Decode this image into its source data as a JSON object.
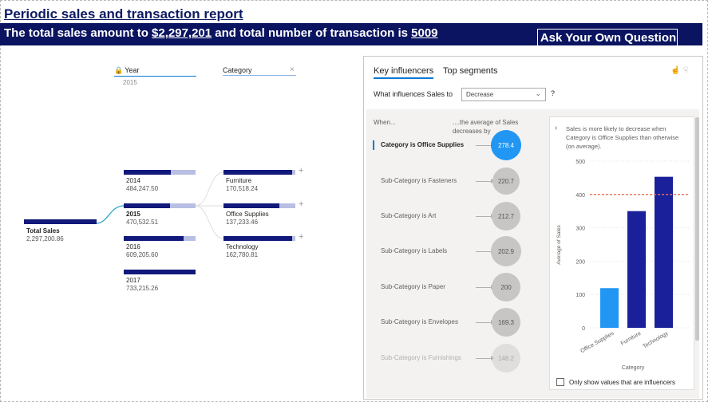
{
  "report": {
    "title": "Periodic sales and transaction report",
    "banner_prefix": "The total sales amount to ",
    "total_sales": "$2,297,201",
    "banner_mid": " and total number of transaction is ",
    "transactions": "5009",
    "ask_button": "Ask Your Own Question",
    "colors": {
      "banner": "#0a1460",
      "bar_dark": "#11197a",
      "bar_light": "#b8bfe3",
      "accent": "#0078d4",
      "bubble_sel": "#2196f3"
    }
  },
  "decomp": {
    "level_year": {
      "label": "Year",
      "sub": "2015",
      "icon": "lock-icon"
    },
    "level_category": {
      "label": "Category",
      "close_icon": "×"
    },
    "root": {
      "name": "Total Sales",
      "value": "2,297,200.86"
    },
    "years": [
      {
        "name": "2014",
        "value": "484,247.50",
        "fill": 0.66,
        "selected": false
      },
      {
        "name": "2015",
        "value": "470,532.51",
        "fill": 0.64,
        "selected": true
      },
      {
        "name": "2016",
        "value": "609,205.60",
        "fill": 0.83,
        "selected": false
      },
      {
        "name": "2017",
        "value": "733,215.26",
        "fill": 1.0,
        "selected": false
      }
    ],
    "categories": [
      {
        "name": "Furniture",
        "value": "170,518.24",
        "fill": 0.95
      },
      {
        "name": "Office Supplies",
        "value": "137,233.46",
        "fill": 0.78
      },
      {
        "name": "Technology",
        "value": "162,780.81",
        "fill": 0.95
      }
    ],
    "plus_glyph": "+"
  },
  "ki": {
    "tabs": [
      "Key influencers",
      "Top segments"
    ],
    "question": "What influences Sales to",
    "dropdown_value": "Decrease",
    "qmark": "?",
    "hdr_when": "When...",
    "hdr_avg": "....the average of Sales decreases by",
    "influencers": [
      {
        "label": "Category is Office Supplies",
        "value": "278.4",
        "size": 38,
        "selected": true
      },
      {
        "label": "Sub-Category is Fasteners",
        "value": "220.7",
        "size": 34
      },
      {
        "label": "Sub-Category is Art",
        "value": "212.7",
        "size": 36
      },
      {
        "label": "Sub-Category is Labels",
        "value": "202.9",
        "size": 38
      },
      {
        "label": "Sub-Category is Paper",
        "value": "200",
        "size": 36
      },
      {
        "label": "Sub-Category is Envelopes",
        "value": "169.3",
        "size": 36
      },
      {
        "label": "Sub-Category is Furnishings",
        "value": "148.2",
        "size": 36,
        "faded": true
      }
    ],
    "detail_text": "Sales is more likely to decrease when Category is Office Supplies than otherwise (on average).",
    "checkbox_label": "Only show values that are influencers"
  },
  "chart_data": {
    "type": "bar",
    "categories": [
      "Office Supplies",
      "Furniture",
      "Technology"
    ],
    "values": [
      119,
      350,
      453
    ],
    "colors": [
      "#2196f3",
      "#1a1f9a",
      "#1a1f9a"
    ],
    "reference_line": 400,
    "ylabel": "Average of Sales",
    "xlabel": "Category",
    "ylim": [
      0,
      500
    ],
    "yticks": [
      "0",
      "100",
      "200",
      "300",
      "400",
      "500"
    ]
  }
}
